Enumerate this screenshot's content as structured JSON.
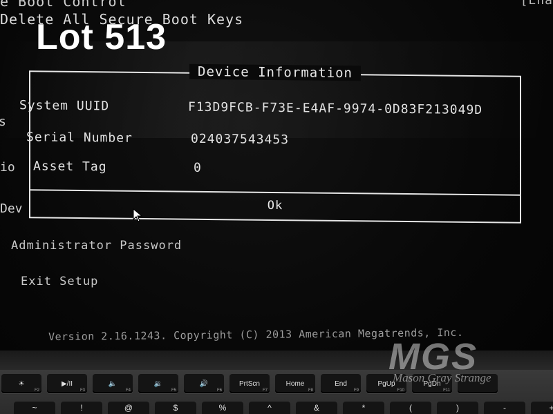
{
  "overlay": {
    "lot_label": "Lot 513"
  },
  "bios": {
    "top_menu": {
      "partial_line_1": "e Boot Control",
      "line_2": "Delete All Secure Boot Keys",
      "right_partial": "[Ena"
    },
    "left_clipped": {
      "s": "s",
      "io": "io",
      "dev": "Dev"
    },
    "dialog": {
      "title": "Device Information",
      "fields": [
        {
          "label": "System UUID",
          "value": "F13D9FCB-F73E-E4AF-9974-0D83F213049D"
        },
        {
          "label": "Serial Number",
          "value": "024037543453"
        },
        {
          "label": "Asset Tag",
          "value": "0"
        }
      ],
      "ok_label": "Ok"
    },
    "menu_items": {
      "admin_password": "Administrator Password",
      "exit_setup": "Exit Setup"
    },
    "version": "Version 2.16.1243. Copyright (C) 2013 American Megatrends, Inc."
  },
  "keyboard": {
    "fn_row": [
      {
        "label": "☀",
        "fn": "F2"
      },
      {
        "label": "▶/II",
        "fn": "F3"
      },
      {
        "label": "🔈",
        "fn": "F4"
      },
      {
        "label": "🔉",
        "fn": "F5"
      },
      {
        "label": "🔊",
        "fn": "F6"
      },
      {
        "label": "PrtScn",
        "fn": "F7"
      },
      {
        "label": "Home",
        "fn": "F8"
      },
      {
        "label": "End",
        "fn": "F9"
      },
      {
        "label": "PgUp",
        "fn": "F10"
      },
      {
        "label": "PgDn",
        "fn": "F11"
      },
      {
        "label": "",
        "fn": ""
      }
    ],
    "num_row": [
      "~",
      "!",
      "@",
      "$",
      "%",
      "^",
      "&",
      "*",
      "(",
      ")",
      "-",
      "+"
    ]
  },
  "watermark": {
    "logo": "MGS",
    "text": "Mason Gray Strange"
  },
  "colors": {
    "screen_bg": "#070707",
    "bios_text": "#dcdcdc",
    "overlay_text": "#ffffff"
  }
}
